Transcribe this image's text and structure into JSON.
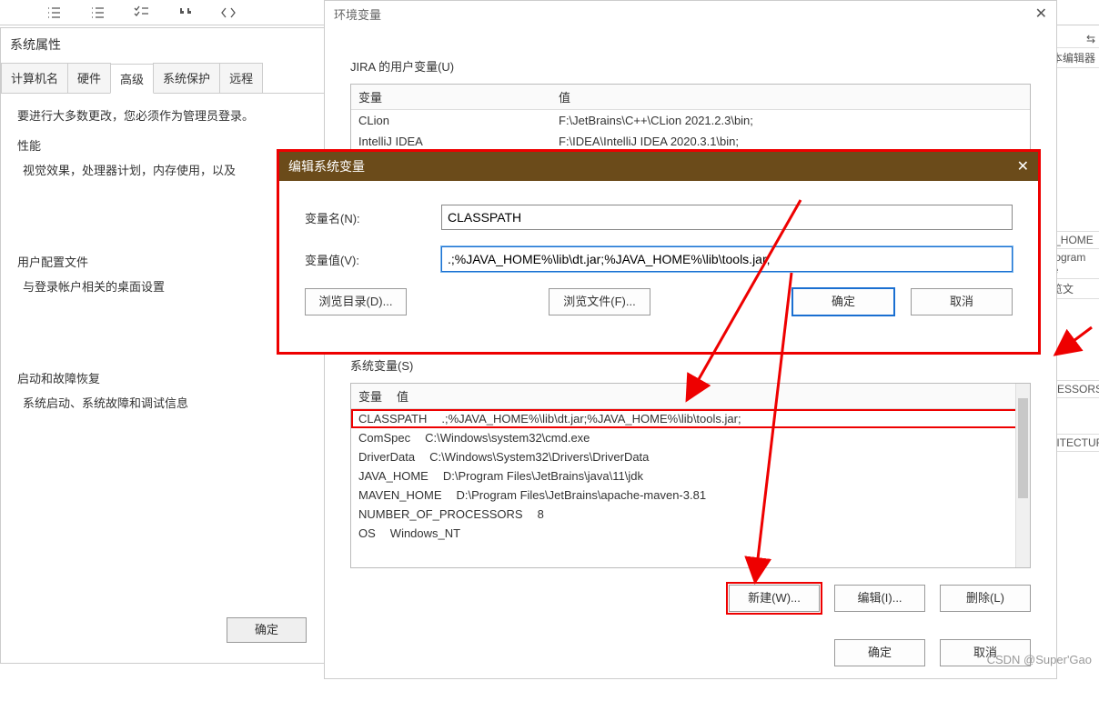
{
  "toolbar_right": "文本编辑器",
  "sysprops": {
    "title": "系统属性",
    "tabs": [
      "计算机名",
      "硬件",
      "高级",
      "系统保护",
      "远程"
    ],
    "active_tab": 2,
    "note": "要进行大多数更改，您必须作为管理员登录。",
    "perf_label": "性能",
    "perf_sub": "视觉效果，处理器计划，内存使用，以及",
    "user_label": "用户配置文件",
    "user_sub": "与登录帐户相关的桌面设置",
    "boot_label": "启动和故障恢复",
    "boot_sub": "系统启动、系统故障和调试信息",
    "ok": "确定"
  },
  "env": {
    "title": "环境变量",
    "user_section": "JIRA 的用户变量(U)",
    "headers": {
      "name": "变量",
      "value": "值"
    },
    "user_rows": [
      {
        "name": "CLion",
        "value": "F:\\JetBrains\\C++\\CLion 2021.2.3\\bin;"
      },
      {
        "name": "IntelliJ IDEA",
        "value": "F:\\IDEA\\IntelliJ IDEA 2020.3.1\\bin;"
      }
    ],
    "sys_section": "系统变量(S)",
    "sys_rows": [
      {
        "name": "CLASSPATH",
        "value": ".;%JAVA_HOME%\\lib\\dt.jar;%JAVA_HOME%\\lib\\tools.jar;"
      },
      {
        "name": "ComSpec",
        "value": "C:\\Windows\\system32\\cmd.exe"
      },
      {
        "name": "DriverData",
        "value": "C:\\Windows\\System32\\Drivers\\DriverData"
      },
      {
        "name": "JAVA_HOME",
        "value": "D:\\Program Files\\JetBrains\\java\\11\\jdk"
      },
      {
        "name": "MAVEN_HOME",
        "value": "D:\\Program Files\\JetBrains\\apache-maven-3.81"
      },
      {
        "name": "NUMBER_OF_PROCESSORS",
        "value": "8"
      },
      {
        "name": "OS",
        "value": "Windows_NT"
      }
    ],
    "new_btn": "新建(W)...",
    "edit_btn": "编辑(I)...",
    "delete_btn": "删除(L)",
    "ok": "确定",
    "cancel": "取消"
  },
  "edit": {
    "title": "编辑系统变量",
    "name_label": "变量名(N):",
    "name_value": "CLASSPATH",
    "value_label": "变量值(V):",
    "value_value": ".;%JAVA_HOME%\\lib\\dt.jar;%JAVA_HOME%\\lib\\tools.jar;",
    "browse_dir": "浏览目录(D)...",
    "browse_file": "浏览文件(F)...",
    "ok": "确定",
    "cancel": "取消"
  },
  "right_hints": [
    "VA_HOME",
    "\\Program File",
    "浏览文",
    "OCESSORS",
    "CHITECTURE"
  ],
  "watermark": "CSDN @Super'Gao"
}
